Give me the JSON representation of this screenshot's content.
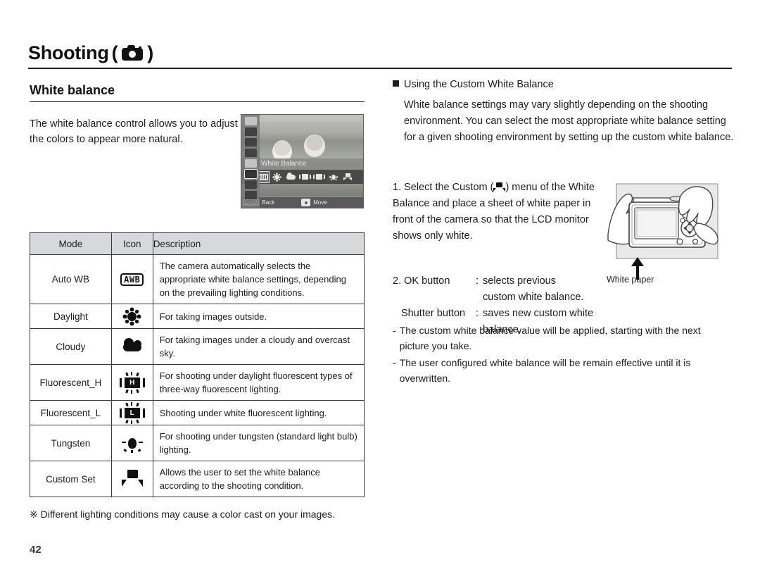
{
  "header": {
    "chapter": "Shooting",
    "paren_open": "(",
    "paren_close": ")",
    "camera_icon": "camera-icon"
  },
  "section": {
    "title": "White balance",
    "intro": "The white balance control allows you to adjust the colors to appear more natural."
  },
  "lcd_figure": {
    "menu_title": "White Balance",
    "back_chip": "MENU",
    "back_label": "Back",
    "move_label": "Move",
    "nav_icon": "four-way-nav-icon",
    "menu_icons": [
      "awb-icon",
      "awb-selected-icon",
      "daylight-sun-icon",
      "cloudy-icon",
      "fluorescent-h-icon",
      "fluorescent-l-icon",
      "tungsten-icon",
      "custom-set-icon"
    ],
    "side_icons": [
      "resolution-icon",
      "quality-icon",
      "movie-icon",
      "scene-icon",
      "iso-icon",
      "white-balance-icon",
      "exposure-icon",
      "drive-icon"
    ]
  },
  "table": {
    "columns": [
      "Mode",
      "Icon",
      "Description"
    ],
    "rows": [
      {
        "mode": "Auto WB",
        "icon": "awb-badge-icon",
        "icon_text": "AWB",
        "description": "The camera automatically selects the appropriate white balance settings, depending on the prevailing lighting conditions."
      },
      {
        "mode": "Daylight",
        "icon": "daylight-sun-icon",
        "icon_text": "",
        "description": "For taking images outside."
      },
      {
        "mode": "Cloudy",
        "icon": "cloudy-icon",
        "icon_text": "",
        "description": "For taking images under a cloudy and overcast sky."
      },
      {
        "mode": "Fluorescent_H",
        "icon": "fluorescent-h-icon",
        "icon_text": "H",
        "description": "For shooting under daylight fluorescent types of three-way fluorescent lighting."
      },
      {
        "mode": "Fluorescent_L",
        "icon": "fluorescent-l-icon",
        "icon_text": "L",
        "description": "Shooting under white fluorescent lighting."
      },
      {
        "mode": "Tungsten",
        "icon": "tungsten-icon",
        "icon_text": "",
        "description": "For shooting under tungsten (standard light bulb) lighting."
      },
      {
        "mode": "Custom Set",
        "icon": "custom-set-icon",
        "icon_text": "",
        "description": "Allows the user to set the white balance according to the shooting condition."
      }
    ],
    "footnote": "※ Different lighting conditions may cause a color cast on your images."
  },
  "right_column": {
    "heading": "Using the Custom White Balance",
    "heading_bullet": "square-bullet-icon",
    "body": "White balance settings may vary slightly depending on the shooting environment. You can select the most appropriate white balance setting for a given shooting environment by setting up the custom white balance.",
    "step1_number": "1.",
    "step1_part1": "Select the Custom (",
    "step1_icon": "custom-set-icon",
    "step1_part2": ") menu of the White Balance and place a sheet of white paper in front of the camera so that the LCD monitor shows only white.",
    "step2_number": "2.",
    "step2_key1": "OK button",
    "step2_sep": ":",
    "step2_val1": "selects previous",
    "step2_val1_cont": "custom white balance.",
    "step2_key2": "Shutter button",
    "step2_val2": "saves new custom white balance.",
    "notes": [
      {
        "dash": "-",
        "text": "The custom white balance value will be applied, starting with the next picture you take."
      },
      {
        "dash": "-",
        "text": "The user configured white balance will be remain effective until it is overwritten."
      }
    ]
  },
  "camera_figure": {
    "white_paper_label": "White paper",
    "arrow_icon": "up-arrow-icon",
    "illustration": "hands-holding-camera-over-white-paper"
  },
  "footer": {
    "page_number": "42"
  },
  "colors": {
    "text": "#1d1d1d",
    "rule": "#1a1a1a",
    "table_header_bg": "#d6d8da",
    "table_border": "#3a3a3a",
    "lcd_bg": "#9a9a9a"
  }
}
